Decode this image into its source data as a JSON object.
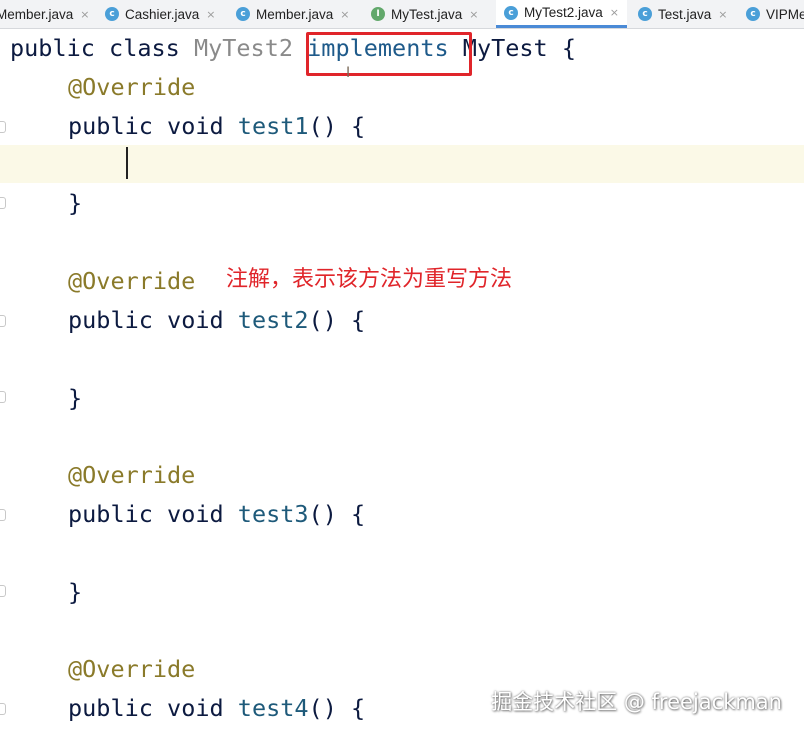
{
  "tabs": [
    {
      "label": "Member.java",
      "icon": "none",
      "active": false
    },
    {
      "label": "Cashier.java",
      "icon": "class-icon",
      "active": false
    },
    {
      "label": "Member.java",
      "icon": "class-icon",
      "active": false
    },
    {
      "label": "MyTest.java",
      "icon": "interface-icon",
      "active": false
    },
    {
      "label": "MyTest2.java",
      "icon": "class-icon",
      "active": true
    },
    {
      "label": "Test.java",
      "icon": "class-icon",
      "active": false
    },
    {
      "label": "VIPMe",
      "icon": "class-icon",
      "active": false
    }
  ],
  "tab_close_glyph": "×",
  "icon_letters": {
    "class": "c",
    "interface": "I"
  },
  "code": {
    "line1": {
      "public": "public",
      "class": "class",
      "name": "MyTest2",
      "implements": "implements",
      "iface": "MyTest",
      "brace": "{"
    },
    "override": "@Override",
    "methods": [
      {
        "sig_public": "public",
        "sig_void": "void",
        "name": "test1",
        "tail": "() {",
        "close": "}"
      },
      {
        "sig_public": "public",
        "sig_void": "void",
        "name": "test2",
        "tail": "() {",
        "close": "}"
      },
      {
        "sig_public": "public",
        "sig_void": "void",
        "name": "test3",
        "tail": "() {",
        "close": "}"
      },
      {
        "sig_public": "public",
        "sig_void": "void",
        "name": "test4",
        "tail": "() {"
      }
    ]
  },
  "annotation_note": "注解，表示该方法为重写方法",
  "watermark": "掘金技术社区 @ freejackman",
  "colors": {
    "highlight_box": "#e0252a",
    "annotation": "#8a7a2a",
    "method_name": "#1e5a7a",
    "active_tab_underline": "#4a8ad6",
    "caret_line": "#fbf9e7"
  }
}
